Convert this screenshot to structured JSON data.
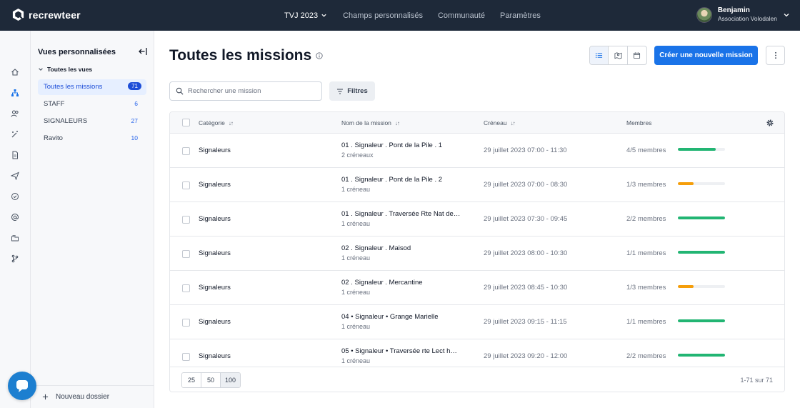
{
  "brand": {
    "name": "recrewteer"
  },
  "topnav": {
    "event": "TVJ 2023",
    "items": [
      "Champs personnalisés",
      "Communauté",
      "Paramètres"
    ]
  },
  "user": {
    "name": "Benjamin",
    "org": "Association Volodalen"
  },
  "rail": {
    "icons": [
      "home-icon",
      "org-chart-icon",
      "users-icon",
      "magic-wand-icon",
      "document-icon",
      "send-icon",
      "check-circle-icon",
      "at-sign-icon",
      "folders-icon",
      "branch-icon"
    ]
  },
  "side": {
    "title": "Vues personnalisées",
    "group": "Toutes les vues",
    "views": [
      {
        "label": "Toutes les missions",
        "count": "71"
      },
      {
        "label": "STAFF",
        "count": "6"
      },
      {
        "label": "SIGNALEURS",
        "count": "27"
      },
      {
        "label": "Ravito",
        "count": "10"
      }
    ],
    "new_folder": "Nouveau dossier"
  },
  "main": {
    "title": "Toutes les missions",
    "create_label": "Créer une nouvelle mission",
    "search_placeholder": "Rechercher une mission",
    "filters_label": "Filtres"
  },
  "table": {
    "headers": {
      "category": "Catégorie",
      "name": "Nom de la mission",
      "slot": "Créneau",
      "members": "Membres"
    },
    "rows": [
      {
        "category": "Signaleurs",
        "name": "01 . Signaleur . Pont de la Pile . 1",
        "sub": "2 créneaux",
        "slot": "29 juillet 2023 07:00 - 11:30",
        "members": "4/5 membres",
        "fill": 0.8,
        "color": "#22b573"
      },
      {
        "category": "Signaleurs",
        "name": "01 . Signaleur . Pont de la Pile . 2",
        "sub": "1 créneau",
        "slot": "29 juillet 2023 07:00 - 08:30",
        "members": "1/3 membres",
        "fill": 0.33,
        "color": "#f59e0b"
      },
      {
        "category": "Signaleurs",
        "name": "01 . Signaleur . Traversée Rte Nat de…",
        "sub": "1 créneau",
        "slot": "29 juillet 2023 07:30 - 09:45",
        "members": "2/2 membres",
        "fill": 1.0,
        "color": "#22b573"
      },
      {
        "category": "Signaleurs",
        "name": "02 . Signaleur . Maisod",
        "sub": "1 créneau",
        "slot": "29 juillet 2023 08:00 - 10:30",
        "members": "1/1 membres",
        "fill": 1.0,
        "color": "#22b573"
      },
      {
        "category": "Signaleurs",
        "name": "02 . Signaleur . Mercantine",
        "sub": "1 créneau",
        "slot": "29 juillet 2023 08:45 - 10:30",
        "members": "1/3 membres",
        "fill": 0.33,
        "color": "#f59e0b"
      },
      {
        "category": "Signaleurs",
        "name": "04 • Signaleur • Grange Marielle",
        "sub": "1 créneau",
        "slot": "29 juillet 2023 09:15 - 11:15",
        "members": "1/1 membres",
        "fill": 1.0,
        "color": "#22b573"
      },
      {
        "category": "Signaleurs",
        "name": "05 • Signaleur • Traversée rte Lect h…",
        "sub": "1 créneau",
        "slot": "29 juillet 2023 09:20 - 12:00",
        "members": "2/2 membres",
        "fill": 1.0,
        "color": "#22b573"
      }
    ],
    "page_sizes": [
      "25",
      "50",
      "100"
    ],
    "active_page_size": "100",
    "range": "1-71 sur 71"
  },
  "colors": {
    "topbar": "#1e2939",
    "accent": "#1a73e8",
    "ok": "#22b573",
    "warn": "#f59e0b"
  }
}
